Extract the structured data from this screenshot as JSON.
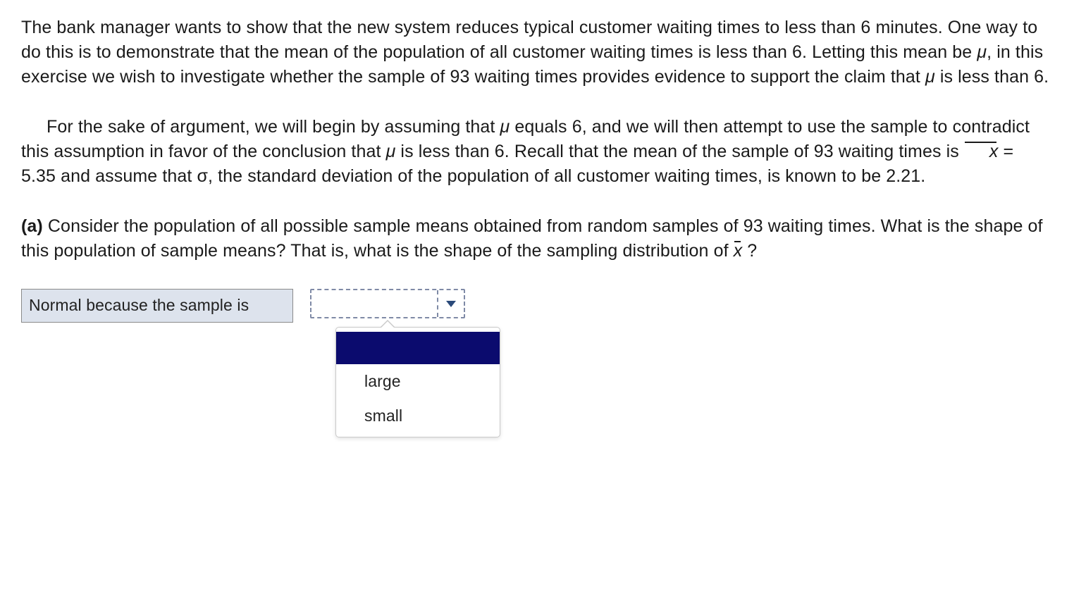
{
  "paragraph1": {
    "t1": "The bank manager wants to show that the new system reduces typical customer waiting times to less than 6 minutes. One way to do this is to demonstrate that the mean of the population of all customer waiting times is less than 6. Letting this mean be ",
    "mu1": "μ",
    "t2": ", in this exercise we wish to investigate whether the sample of 93 waiting times provides evidence to support the claim that ",
    "mu2": "μ",
    "t3": " is less than 6."
  },
  "paragraph2": {
    "t1": "For the sake of argument, we will begin by assuming that ",
    "mu1": "μ",
    "t2": " equals 6, and we will then attempt to use the sample to contradict this assumption in favor of the conclusion that ",
    "mu2": "μ",
    "t3": " is less than 6. Recall that the mean of the sample of 93 waiting times is ",
    "xbar": "x",
    "t4": "  = 5.35 and assume that ",
    "sigma": "σ",
    "t5": ", the standard deviation of the population of all customer waiting times, is known to be 2.21."
  },
  "question_a": {
    "label": "(a)",
    "t1": " Consider the population of all possible sample means obtained from random samples of 93 waiting times. What is the shape of this population of sample means? That is, what is the shape of the sampling distribution of ",
    "xbar": "x",
    "t2": " ?"
  },
  "answer": {
    "stem": "Normal because the sample is",
    "selected_value": "",
    "options": [
      "",
      "large",
      "small"
    ]
  }
}
